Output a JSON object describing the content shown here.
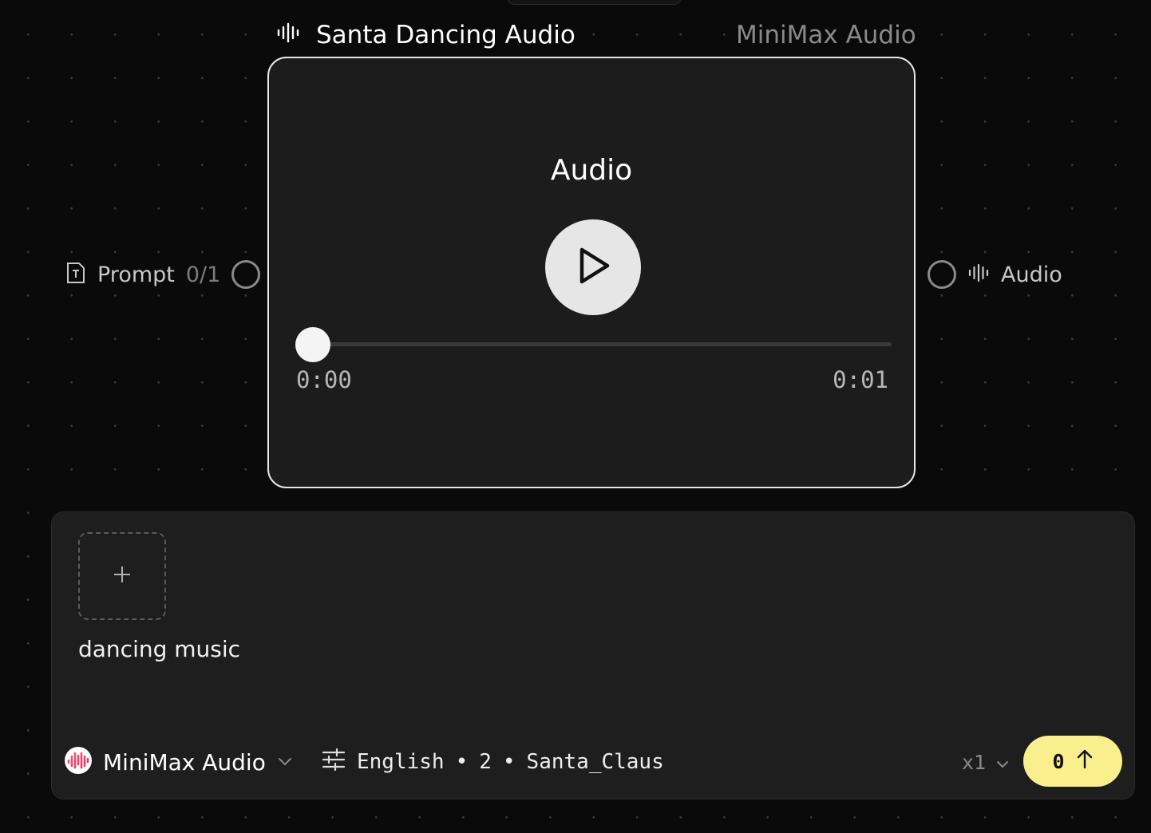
{
  "node": {
    "title": "Santa Dancing Audio",
    "model": "MiniMax Audio",
    "output_label": "Audio"
  },
  "player": {
    "current_time": "0:00",
    "duration": "0:01",
    "progress": 0
  },
  "ports": {
    "input_label": "Prompt",
    "input_count": "0/1",
    "output_label": "Audio"
  },
  "panel": {
    "prompt_text": "dancing music",
    "model_name": "MiniMax Audio",
    "settings": {
      "language": "English",
      "separator": "•",
      "count": "2",
      "voice": "Santa_Claus"
    },
    "multiplier": "x1",
    "run_cost": "0"
  },
  "colors": {
    "background": "#0a0a0a",
    "card": "#1c1c1c",
    "accent_button": "#f9ef8c",
    "card_border": "#e8e8e8"
  },
  "icons": [
    "waveform-icon",
    "play-icon",
    "text-icon",
    "plus-icon",
    "minimax-logo-icon",
    "chevron-down-icon",
    "sliders-icon",
    "arrow-up-icon"
  ]
}
